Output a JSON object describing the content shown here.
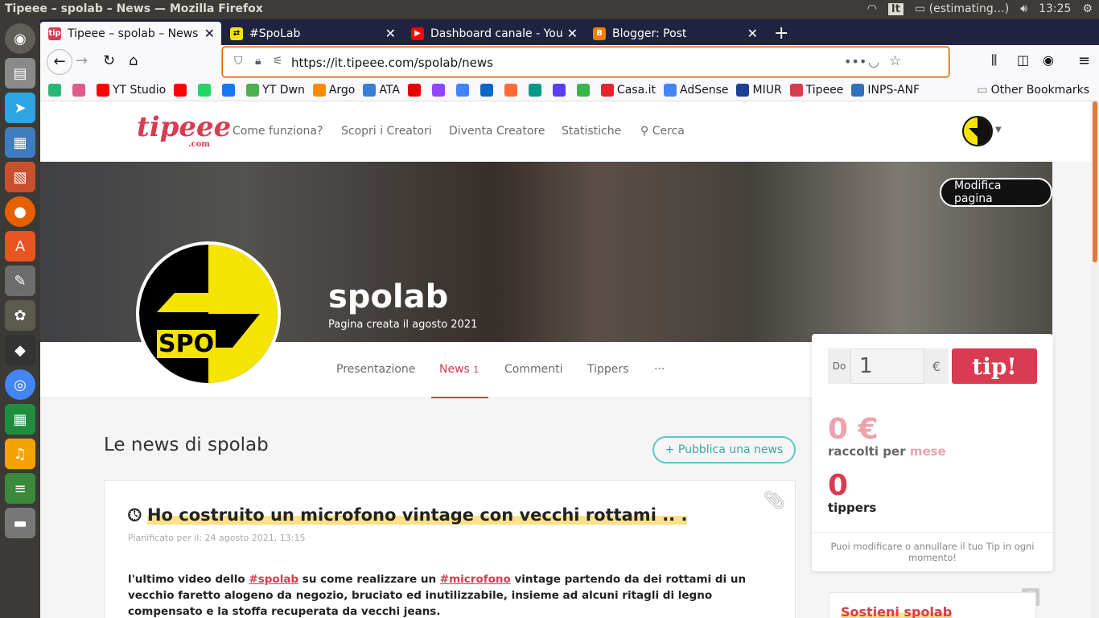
{
  "os": {
    "window_title": "Tipeee – spolab – News — Mozilla Firefox",
    "keyboard_layout": "It",
    "battery": "(estimating…)",
    "clock": "13:25"
  },
  "tabs": [
    {
      "label": "Tipeee – spolab – News",
      "favicon": "tipeee",
      "color": "#d93b52"
    },
    {
      "label": "#SpoLab",
      "favicon": "spolab",
      "color": "#222222"
    },
    {
      "label": "Dashboard canale - YouT",
      "favicon": "youtube",
      "color": "#ff0000"
    },
    {
      "label": "Blogger: Post",
      "favicon": "blogger",
      "color": "#f57d00"
    }
  ],
  "url": "https://it.tipeee.com/spolab/news",
  "bookmarks": [
    {
      "label": "",
      "icon": "check-badge",
      "color": "#2bb673"
    },
    {
      "label": "",
      "icon": "infinity",
      "color": "#e05b8a"
    },
    {
      "label": "YT Studio",
      "icon": "youtube",
      "color": "#ff0000"
    },
    {
      "label": "",
      "icon": "youtube",
      "color": "#ff0000"
    },
    {
      "label": "",
      "icon": "whatsapp",
      "color": "#25d366"
    },
    {
      "label": "",
      "icon": "facebook",
      "color": "#1877f2"
    },
    {
      "label": "YT Dwn",
      "icon": "download-arrow",
      "color": "#4caf50"
    },
    {
      "label": "Argo",
      "icon": "argo",
      "color": "#ff8a00"
    },
    {
      "label": "ATA",
      "icon": "ata",
      "color": "#3b7dd8"
    },
    {
      "label": "",
      "icon": "vodafone",
      "color": "#e60000"
    },
    {
      "label": "",
      "icon": "twitch",
      "color": "#9146ff"
    },
    {
      "label": "",
      "icon": "google",
      "color": "#4285f4"
    },
    {
      "label": "",
      "icon": "linkedin",
      "color": "#0a66c2"
    },
    {
      "label": "",
      "icon": "bg",
      "color": "#ff6b35"
    },
    {
      "label": "",
      "icon": "n-letter",
      "color": "#009688"
    },
    {
      "label": "",
      "icon": "c-circle",
      "color": "#5b3df5"
    },
    {
      "label": "",
      "icon": "swirl",
      "color": "#3ab34a"
    },
    {
      "label": "Casa.it",
      "icon": "casa",
      "color": "#e3262d"
    },
    {
      "label": "AdSense",
      "icon": "google-g",
      "color": "#4285f4"
    },
    {
      "label": "MIUR",
      "icon": "miur",
      "color": "#1d3f8f"
    },
    {
      "label": "Tipeee",
      "icon": "tipeee",
      "color": "#d93b52"
    },
    {
      "label": "INPS-ANF",
      "icon": "inps",
      "color": "#3071b8"
    }
  ],
  "other_bookmarks": "Other Bookmarks",
  "site": {
    "logo": "tipeee",
    "logo_suffix": ".com",
    "menu": [
      "Come funziona?",
      "Scopri i Creatori",
      "Diventa Creatore",
      "Statistiche"
    ],
    "search": "Cerca",
    "edit_button": "Modifica pagina",
    "profile_name": "spolab",
    "profile_sub": "Pagina creata il agosto 2021",
    "avatar_text": "SPO"
  },
  "subnav": [
    {
      "label": "Presentazione"
    },
    {
      "label": "News",
      "count": "1"
    },
    {
      "label": "Commenti"
    },
    {
      "label": "Tippers"
    },
    {
      "label": "···"
    }
  ],
  "news": {
    "heading": "Le news di spolab",
    "publish_button": "+ Pubblica una news",
    "post": {
      "title": "Ho costruito un microfono vintage con vecchi rottami .. .",
      "scheduled": "Pianificato per il: 24 agosto 2021, 13:15",
      "body_1": "l'ultimo video dello ",
      "tag_1": "#spolab",
      "body_2": " su come realizzare un ",
      "tag_2": "#microfono",
      "body_3": " vintage partendo da dei rottami di un vecchio faretto alogeno da negozio, bruciato ed inutilizzabile, insieme ad alcuni ritagli di legno compensato e la stoffa recuperata da vecchi jeans."
    }
  },
  "tipbox": {
    "prefix": "Do",
    "amount": "1",
    "currency": "€",
    "tip_button": "tip!",
    "collected": "0 €",
    "collected_label": "raccolti per",
    "period": "mese",
    "tippers_count": "0",
    "tippers_label": "tippers",
    "note": "Puoi modificare o annullare il tuo Tip in ogni momento!"
  },
  "sostieni": "Sostieni spolab",
  "colors": {
    "brand": "#d93b52",
    "accent": "#5ec7c2",
    "highlight": "#fde08a"
  }
}
